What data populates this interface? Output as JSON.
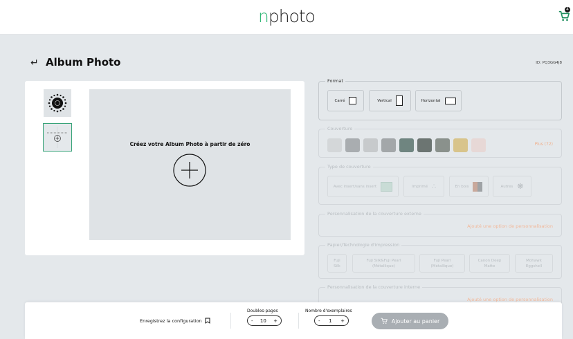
{
  "header": {
    "logo_prefix": "n",
    "logo_rest": "photo",
    "cart_count": "4"
  },
  "page": {
    "title": "Album Photo",
    "product_id": "ID: PQ3GG4J8"
  },
  "preview": {
    "create_text": "Créez votre Album Photo à partir de zéro"
  },
  "format": {
    "legend": "Format",
    "options": [
      {
        "label": "Carré"
      },
      {
        "label": "Vertical"
      },
      {
        "label": "Horizontal"
      }
    ]
  },
  "couverture": {
    "legend": "Couverture",
    "swatch_colors": [
      "#d4d7d9",
      "#a9adb0",
      "#c7cacc",
      "#a3a7a9",
      "#6f8580",
      "#6c7572",
      "#8a918c",
      "#d8c48b",
      "#e7d8d6"
    ],
    "more_label": "Plus (72)"
  },
  "type_couverture": {
    "legend": "Type de couverture",
    "options": [
      {
        "label": "Avec insert/sans insert"
      },
      {
        "label": "Imprimé"
      },
      {
        "label": "En bois"
      },
      {
        "label": "Autres"
      }
    ]
  },
  "perso_externe": {
    "legend": "Personnalisation de la couverture externe",
    "add_label": "Ajouté une option de personnalisation"
  },
  "papier": {
    "legend": "Papier/Technologie d'impression",
    "options": [
      {
        "line1": "Fuji",
        "line2": "Silk"
      },
      {
        "line1": "Fuji Silk&Fuji Pearl",
        "line2": "(Métallique)"
      },
      {
        "line1": "Fuji Pearl",
        "line2": "(Métallique)"
      },
      {
        "line1": "Canon Deep",
        "line2": "Matte"
      },
      {
        "line1": "Mohawk",
        "line2": "Eggshell"
      }
    ]
  },
  "perso_interne": {
    "legend": "Personnalisation de la couverture interne",
    "add_label": "Ajouté une option de personnalisation"
  },
  "bottom": {
    "save_label": "Enregistrez la configuration",
    "doubles_label": "Doubles-pages",
    "doubles_value": "10",
    "exemplaires_label": "Nombre d'exemplaires",
    "exemplaires_value": "1",
    "minus": "-",
    "plus": "+",
    "add_to_cart": "Ajouter au panier"
  }
}
